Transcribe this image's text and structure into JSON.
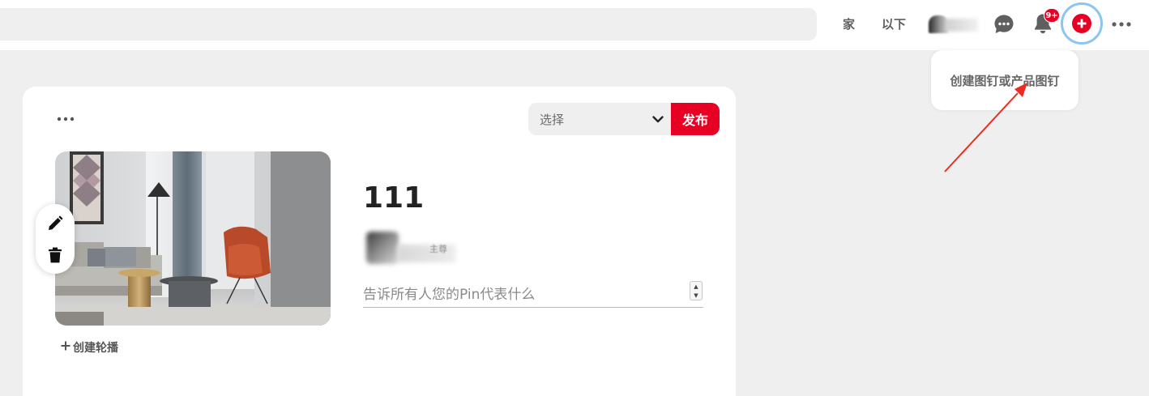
{
  "header": {
    "search_placeholder": "",
    "nav_home": "家",
    "nav_following": "以下",
    "notification_badge": "9+",
    "icons": [
      "message-icon",
      "bell-icon",
      "plus-circle-icon",
      "more-horizontal-icon"
    ]
  },
  "tooltip": {
    "text": "创建图钉或产品图钉"
  },
  "pin_editor": {
    "board_select": {
      "selected": "选择"
    },
    "publish_label": "发布",
    "title": "111",
    "user_name": "主尊",
    "description_placeholder": "告诉所有人您的Pin代表什么",
    "create_carousel_label": "创建轮播"
  },
  "colors": {
    "brand_red": "#e60023",
    "page_background": "#efefef",
    "focus_ring": "#8bc4f5",
    "annotation_arrow": "#ee2a22"
  }
}
